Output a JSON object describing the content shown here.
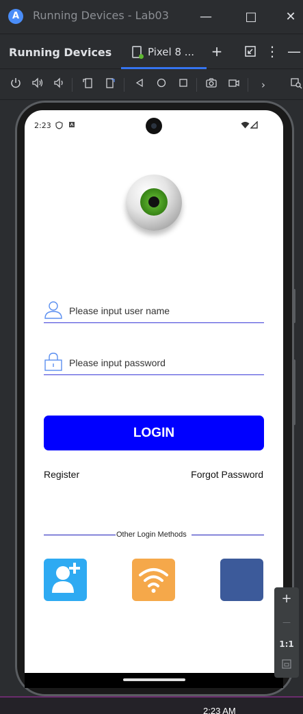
{
  "window": {
    "title": "Running Devices - Lab03",
    "minimize": "—",
    "maximize": "□",
    "close": "✕"
  },
  "tool_window": {
    "title": "Running Devices",
    "tab_label": "Pixel 8 ...",
    "add": "+",
    "more": "⋮",
    "hide": "—"
  },
  "toolbar": {
    "more": "›"
  },
  "phone_status": {
    "time": "2:23"
  },
  "app": {
    "username_placeholder": "Please input user name",
    "password_placeholder": "Please input password",
    "login_label": "LOGIN",
    "register_label": "Register",
    "forgot_label": "Forgot Password",
    "other_methods_label": "Other Login Methods",
    "methods": [
      {
        "icon": "add-user-icon",
        "color": "#2eaaf2"
      },
      {
        "icon": "wifi-icon",
        "color": "#f5a84a"
      },
      {
        "icon": "blank-icon",
        "color": "#3c5a9a"
      }
    ],
    "colors": {
      "accent": "#0000ff",
      "underline": "#3a3ad8"
    }
  },
  "zoom": {
    "zoom_in": "+",
    "zoom_out": "—",
    "actual_size": "1:1"
  },
  "taskbar": {
    "time": "2:23 AM"
  }
}
